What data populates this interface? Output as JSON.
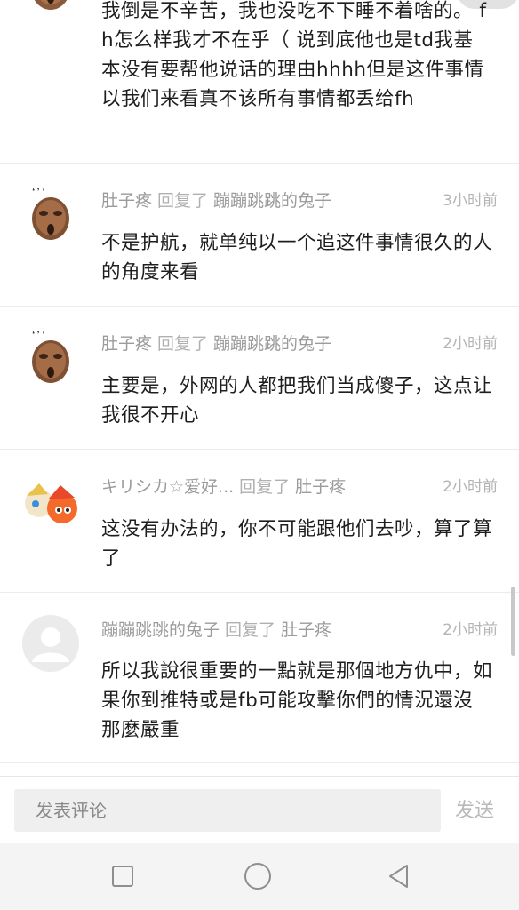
{
  "comments": [
    {
      "avatar": "mask-icon",
      "author": "",
      "reply_word": "",
      "target": "",
      "time": "",
      "text": "我倒是不辛苦，我也没吃不下睡不着啥的。 fh怎么样我才不在乎（ 说到底他也是td我基本没有要帮他说话的理由hhhh但是这件事情以我们来看真不该所有事情都丢给fh"
    },
    {
      "avatar": "mask-icon",
      "author": "肚子疼",
      "reply_word": "回复了",
      "target": "蹦蹦跳跳的兔子",
      "time": "3小时前",
      "text": "不是护航，就单纯以一个追这件事情很久的人的角度来看"
    },
    {
      "avatar": "mask-icon",
      "author": "肚子疼",
      "reply_word": "回复了",
      "target": "蹦蹦跳跳的兔子",
      "time": "2小时前",
      "text": "主要是，外网的人都把我们当成傻子，这点让我很不开心"
    },
    {
      "avatar": "anime-avatar-icon",
      "author": "キリシカ☆爱好...",
      "reply_word": "回复了",
      "target": "肚子疼",
      "time": "2小时前",
      "text": "这没有办法的，你不可能跟他们去吵，算了算了"
    },
    {
      "avatar": "default-user-icon",
      "author": "蹦蹦跳跳的兔子",
      "reply_word": "回复了",
      "target": "肚子疼",
      "time": "2小时前",
      "text": "所以我說很重要的一點就是那個地方仇中，如果你到推特或是fb可能攻擊你們的情況還沒那麼嚴重"
    }
  ],
  "input": {
    "placeholder": "发表评论",
    "value": ""
  },
  "send_label": "发送",
  "navbar": {
    "icons": [
      "square-recent-apps-icon",
      "circle-home-icon",
      "triangle-back-icon"
    ]
  },
  "colors": {
    "meta_text": "#9b9b9b",
    "body_text": "#1e1e1e",
    "input_bg": "#efefef",
    "nav_bg": "#f4f4f4"
  }
}
